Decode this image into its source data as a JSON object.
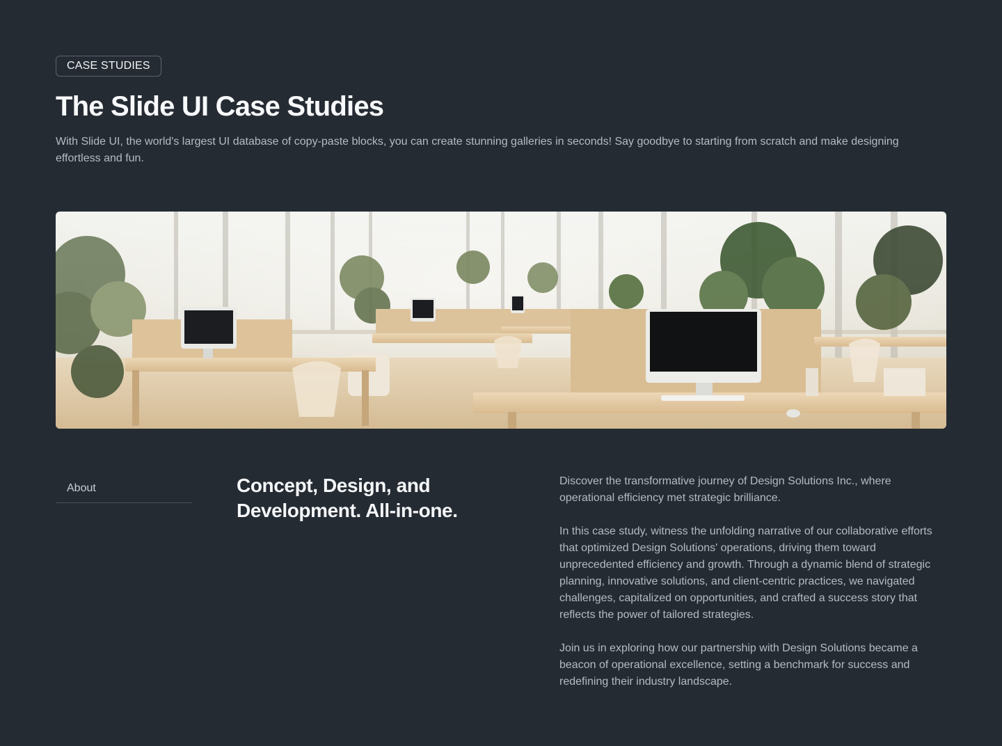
{
  "header": {
    "badge": "CASE STUDIES",
    "title": "The Slide UI Case Studies",
    "intro": "With Slide UI, the world's largest UI database of copy-paste blocks, you can create stunning galleries in seconds! Say goodbye to starting from scratch and make designing effortless and fun."
  },
  "hero": {
    "image": "bright-office-workspace-photo"
  },
  "nav": {
    "about_label": "About"
  },
  "section": {
    "title": "Concept, Design, and Development. All-in-one.",
    "paragraphs": [
      "Discover the transformative journey of Design Solutions Inc., where operational efficiency met strategic brilliance.",
      " In this case study, witness the unfolding narrative of our collaborative efforts that optimized Design Solutions' operations, driving them toward unprecedented efficiency and growth. Through a dynamic blend of strategic planning, innovative solutions, and client-centric practices, we navigated challenges, capitalized on opportunities, and crafted a success story that reflects the power of tailored strategies.",
      " Join us in exploring how our partnership with Design Solutions became a beacon of operational excellence, setting a benchmark for success and redefining their industry landscape."
    ]
  },
  "colors": {
    "background": "#252b33",
    "text_primary": "#f4f6f8",
    "text_muted": "#b4bbc3",
    "border": "#5b636d"
  }
}
